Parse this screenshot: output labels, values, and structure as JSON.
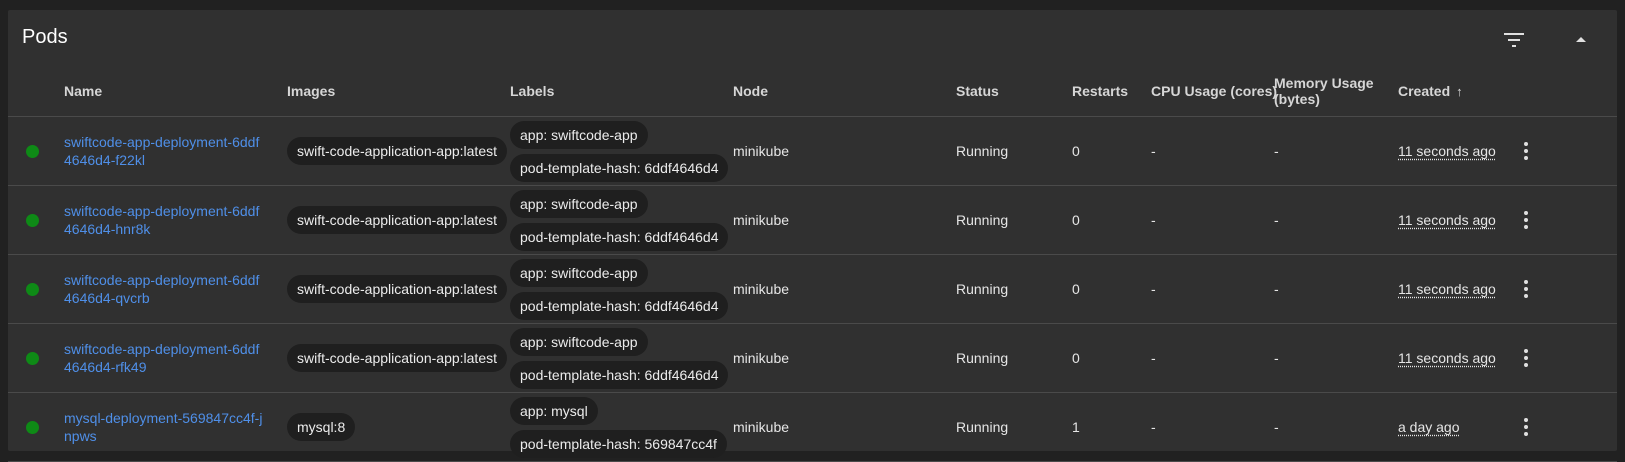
{
  "card": {
    "title": "Pods"
  },
  "header_icons": {
    "filter": "filter-icon",
    "collapse": "chevron-up-icon"
  },
  "columns": {
    "name": "Name",
    "images": "Images",
    "labels": "Labels",
    "node": "Node",
    "status": "Status",
    "restarts": "Restarts",
    "cpu": "CPU Usage (cores)",
    "memory": "Memory Usage (bytes)",
    "created": "Created",
    "created_sort": "↑"
  },
  "colors": {
    "status_running": "#0e8a16",
    "link": "#4f8fe8",
    "background": "#303030"
  },
  "pods": [
    {
      "name": "swiftcode-app-deployment-6ddf4646d4-f22kl",
      "image": "swift-code-application-app:latest",
      "labels": [
        "app: swiftcode-app",
        "pod-template-hash: 6ddf4646d4"
      ],
      "node": "minikube",
      "status": "Running",
      "restarts": "0",
      "cpu": "-",
      "memory": "-",
      "created": "11 seconds ago"
    },
    {
      "name": "swiftcode-app-deployment-6ddf4646d4-hnr8k",
      "image": "swift-code-application-app:latest",
      "labels": [
        "app: swiftcode-app",
        "pod-template-hash: 6ddf4646d4"
      ],
      "node": "minikube",
      "status": "Running",
      "restarts": "0",
      "cpu": "-",
      "memory": "-",
      "created": "11 seconds ago"
    },
    {
      "name": "swiftcode-app-deployment-6ddf4646d4-qvcrb",
      "image": "swift-code-application-app:latest",
      "labels": [
        "app: swiftcode-app",
        "pod-template-hash: 6ddf4646d4"
      ],
      "node": "minikube",
      "status": "Running",
      "restarts": "0",
      "cpu": "-",
      "memory": "-",
      "created": "11 seconds ago"
    },
    {
      "name": "swiftcode-app-deployment-6ddf4646d4-rfk49",
      "image": "swift-code-application-app:latest",
      "labels": [
        "app: swiftcode-app",
        "pod-template-hash: 6ddf4646d4"
      ],
      "node": "minikube",
      "status": "Running",
      "restarts": "0",
      "cpu": "-",
      "memory": "-",
      "created": "11 seconds ago"
    },
    {
      "name": "mysql-deployment-569847cc4f-jnpws",
      "image": "mysql:8",
      "labels": [
        "app: mysql",
        "pod-template-hash: 569847cc4f"
      ],
      "node": "minikube",
      "status": "Running",
      "restarts": "1",
      "cpu": "-",
      "memory": "-",
      "created": "a day ago"
    }
  ]
}
